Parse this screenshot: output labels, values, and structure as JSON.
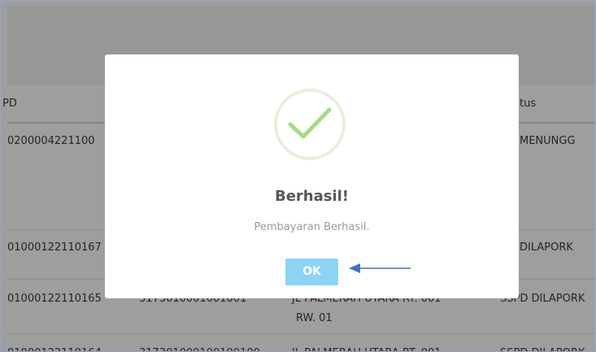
{
  "table": {
    "headers": {
      "col_1": "PD",
      "col_status": "tus"
    },
    "rows": [
      {
        "col_1": "0200004221100",
        "col_3_line1": "",
        "col_3_line2": "",
        "col_2": "",
        "status": "PD MENUNGG"
      },
      {
        "col_1": "01000122110167",
        "col_3_line1": "",
        "col_3_line2": "",
        "col_2": "",
        "status": "PD DILAPORK"
      },
      {
        "col_1": "01000122110165",
        "col_2": "3173010001001001",
        "col_3_line1": "JL PALMERAH UTARA RT. 001",
        "col_3_line2": "RW. 01",
        "status": "SSPD DILAPORK"
      },
      {
        "col_1": "01000122110164",
        "col_2": "317301000100100100",
        "col_3_line1": "JL PALMERAH UTARA RT. 001",
        "col_3_line2": "",
        "status": "SSPD DILAPORK"
      }
    ]
  },
  "modal": {
    "icon": "checkmark-icon",
    "title": "Berhasil!",
    "message": "Pembayaran Berhasil.",
    "ok_label": "OK",
    "ok_color": "#8cd4f5",
    "check_color": "#a5dc86"
  },
  "annotation": {
    "arrow_color": "#4472c4",
    "arrow_icon": "arrow-left-icon"
  }
}
